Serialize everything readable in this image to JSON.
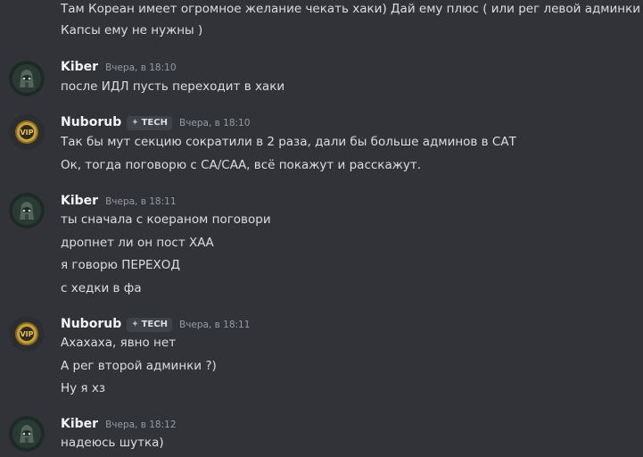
{
  "messages": [
    {
      "lines": [
        "Там Кореан имеет огромное желание чекать хаки) Дай ему плюс ( или рег левой админки ",
        "Капсы ему не нужны )"
      ],
      "line1_suffix": ")"
    },
    {
      "author": "Kiber",
      "timestamp": "Вчера, в 18:10",
      "avatar_icon": "dark-helmet-avatar",
      "lines": [
        "после ИДЛ пусть переходит в хаки"
      ]
    },
    {
      "author": "Nuborub",
      "tag": "TECH",
      "tag_icon": "diamond-sparkle-icon",
      "timestamp": "Вчера, в 18:10",
      "avatar_icon": "gold-emblem-avatar",
      "lines": [
        "Так бы мут секцию сократили в 2 раза, дали бы больше админов в САТ",
        "Ок, тогда поговорю с СА/САА, всё покажут и расскажут."
      ]
    },
    {
      "author": "Kiber",
      "timestamp": "Вчера, в 18:11",
      "avatar_icon": "dark-helmet-avatar",
      "lines": [
        "ты сначала с коераном поговори",
        "дропнет ли он пост ХАА",
        "я говорю ПЕРЕХОД",
        "с хедки в фа"
      ]
    },
    {
      "author": "Nuborub",
      "tag": "TECH",
      "tag_icon": "diamond-sparkle-icon",
      "timestamp": "Вчера, в 18:11",
      "avatar_icon": "gold-emblem-avatar",
      "lines": [
        "Ахахаха, явно нет",
        "А рег второй админки ?)",
        "Ну я хз"
      ]
    },
    {
      "author": "Kiber",
      "timestamp": "Вчера, в 18:12",
      "avatar_icon": "dark-helmet-avatar",
      "lines": [
        "надеюсь шутка)"
      ]
    }
  ],
  "colors": {
    "background": "#313338",
    "text": "#dbdee1",
    "username": "#f2f3f5",
    "timestamp": "#949ba4",
    "tag_bg": "#3f4248",
    "emoji": "#ffcc4d"
  }
}
